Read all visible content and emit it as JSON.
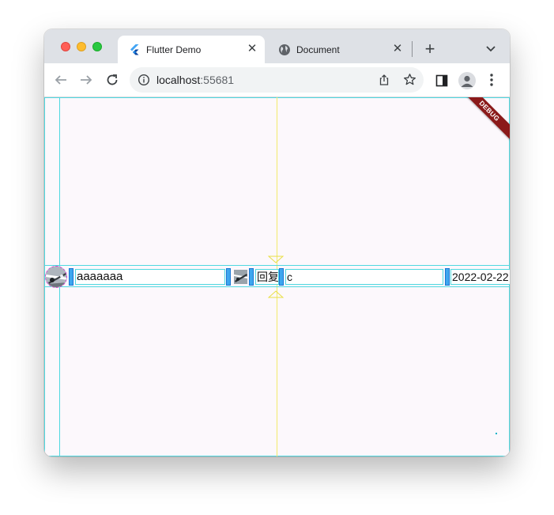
{
  "browser": {
    "tabs": [
      {
        "title": "Flutter Demo",
        "active": true,
        "favicon": "flutter-icon"
      },
      {
        "title": "Document",
        "active": false,
        "favicon": "globe-icon"
      }
    ],
    "new_tab_label": "+",
    "close_label": "✕",
    "address": {
      "host": "localhost",
      "port": ":55681"
    }
  },
  "app": {
    "debug_banner": "DEBUG",
    "row": {
      "name": "aaaaaaa",
      "reply_label": "回复",
      "reply_text": "c",
      "date": "2022-02-22"
    }
  },
  "colors": {
    "guide_cyan": "#4fd8e0",
    "guide_yellow": "#f3ea6a",
    "debug_red": "#8b1a1a",
    "bar_blue": "#3ea6ef"
  }
}
